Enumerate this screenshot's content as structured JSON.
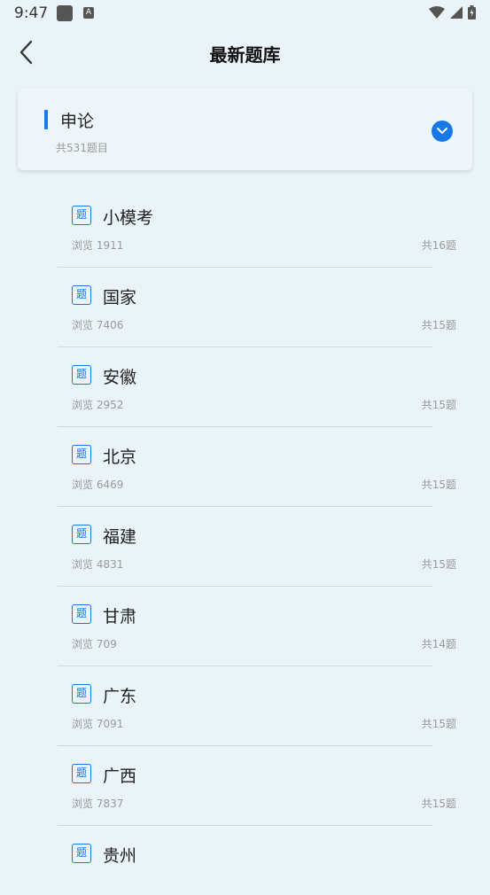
{
  "status": {
    "time": "9:47",
    "app_badge": "A"
  },
  "header": {
    "title": "最新题库"
  },
  "category": {
    "name": "申论",
    "subtitle": "共531题目"
  },
  "items": [
    {
      "tag": "题",
      "name": "小模考",
      "views": "浏览 1911",
      "count": "共16题"
    },
    {
      "tag": "题",
      "name": "国家",
      "views": "浏览 7406",
      "count": "共15题"
    },
    {
      "tag": "题",
      "name": "安徽",
      "views": "浏览 2952",
      "count": "共15题"
    },
    {
      "tag": "题",
      "name": "北京",
      "views": "浏览 6469",
      "count": "共15题"
    },
    {
      "tag": "题",
      "name": "福建",
      "views": "浏览 4831",
      "count": "共15题"
    },
    {
      "tag": "题",
      "name": "甘肃",
      "views": "浏览 709",
      "count": "共14题"
    },
    {
      "tag": "题",
      "name": "广东",
      "views": "浏览 7091",
      "count": "共15题"
    },
    {
      "tag": "题",
      "name": "广西",
      "views": "浏览 7837",
      "count": "共15题"
    },
    {
      "tag": "题",
      "name": "贵州",
      "views": "",
      "count": ""
    }
  ],
  "colors": {
    "accent": "#1677e6",
    "background": "#eaf3f8"
  },
  "icons": {
    "back": "chevron-left-icon",
    "expand": "chevron-down-circle-icon"
  }
}
